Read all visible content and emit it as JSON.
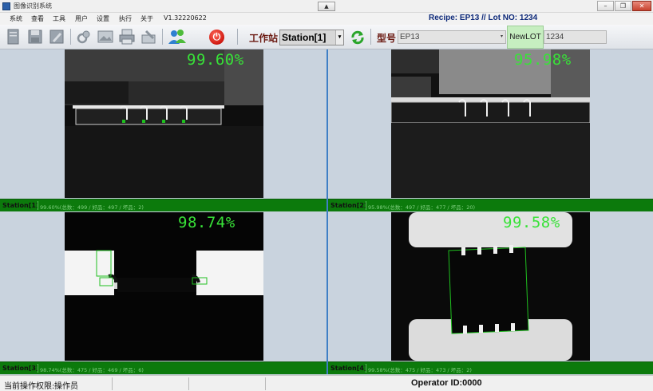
{
  "window": {
    "title": "图像识别系统",
    "collapse_glyph": "▲",
    "min_glyph": "–",
    "max_glyph": "❐",
    "close_glyph": "✕"
  },
  "menu": {
    "items": [
      "系统",
      "查看",
      "工具",
      "用户",
      "设置",
      "执行",
      "关于"
    ],
    "version": "V1.32220622",
    "recipe_text": "Recipe: EP13  // Lot NO: 1234"
  },
  "toolbar": {
    "station_label": "工作站",
    "station_value": "Station[1]",
    "model_label": "型号",
    "model_value": "EP13",
    "newlot_label": "NewLOT",
    "lot_value": "1234",
    "icons": [
      "new-file-icon",
      "save-icon",
      "edit-icon",
      "inspect-icon",
      "image-icon",
      "print-icon",
      "clear-icon",
      "users-icon",
      "power-icon",
      "refresh-icon"
    ]
  },
  "panels": [
    {
      "name": "Station[1]",
      "percent": "99.60%",
      "detail": "99.60%(总数：499 / 好品：497 / 坏品：2)"
    },
    {
      "name": "Station[2]",
      "percent": "95.98%",
      "detail": "95.98%(总数：497 / 好品：477 / 坏品：20)"
    },
    {
      "name": "Station[3]",
      "percent": "98.74%",
      "detail": "98.74%(总数：475 / 好品：469 / 坏品：6)"
    },
    {
      "name": "Station[4]",
      "percent": "99.58%",
      "detail": "99.58%(总数：475 / 好品：473 / 坏品：2)"
    }
  ],
  "statusbar": {
    "permission_label": "当前操作权限:",
    "permission_value": "操作员",
    "operator": "Operator ID:0000"
  },
  "colors": {
    "status_green": "#0c7a0c",
    "percent_green": "#38e238",
    "panel_bg": "#c9d3de",
    "divider_blue": "#3f7fc5"
  }
}
